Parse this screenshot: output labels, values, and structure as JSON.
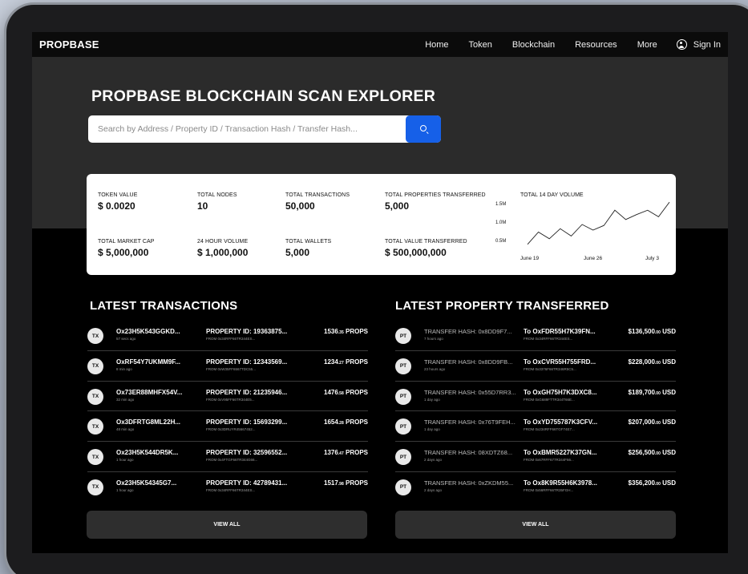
{
  "nav": {
    "logo": "PROPBASE",
    "links": [
      "Home",
      "Token",
      "Blockchain",
      "Resources",
      "More"
    ],
    "signin": "Sign In"
  },
  "hero": {
    "title": "PROPBASE BLOCKCHAIN SCAN EXPLORER",
    "search_placeholder": "Search by Address / Property ID / Transaction Hash / Transfer Hash..."
  },
  "stats": [
    {
      "label": "TOKEN VALUE",
      "value": "$ 0.0020"
    },
    {
      "label": "TOTAL NODES",
      "value": "10"
    },
    {
      "label": "TOTAL TRANSACTIONS",
      "value": "50,000"
    },
    {
      "label": "TOTAL PROPERTIES TRANSFERRED",
      "value": "5,000"
    },
    {
      "label": "TOTAL MARKET CAP",
      "value": "$ 5,000,000"
    },
    {
      "label": "24 HOUR VOLUME",
      "value": "$ 1,000,000"
    },
    {
      "label": "TOTAL WALLETS",
      "value": "5,000"
    },
    {
      "label": "TOTAL VALUE TRANSFERRED",
      "value": "$ 500,000,000"
    }
  ],
  "chart_data": {
    "type": "line",
    "title": "TOTAL 14 DAY VOLUME",
    "y_ticks": [
      "1.5M",
      "1.0M",
      "0.5M"
    ],
    "x_ticks": [
      "June 19",
      "June 26",
      "July 3"
    ],
    "values": [
      0.35,
      0.72,
      0.52,
      0.82,
      0.6,
      0.95,
      0.78,
      0.92,
      1.38,
      1.1,
      1.25,
      1.38,
      1.18,
      1.62
    ]
  },
  "transactions": {
    "title": "LATEST TRANSACTIONS",
    "badge": "TX",
    "unit": "PROPS",
    "rows": [
      {
        "hash": "Ox23H5K543GGKD...",
        "time": "57 secs ago",
        "property": "PROPERTY ID: 19363875...",
        "from": "FROM 0x34RFF66TR344ES...",
        "amount": "1536",
        "decimals": ".35"
      },
      {
        "hash": "OxRF54Y7UKMM9F...",
        "time": "8 min ago",
        "property": "PROPERTY ID: 12343569...",
        "from": "FROM 0xW35FF6567TDC55...",
        "amount": "1234",
        "decimals": ".27"
      },
      {
        "hash": "Ox73ER88MHFX54V...",
        "time": "32 min ago",
        "property": "PROPERTY ID: 21235946...",
        "from": "FROM 0xV95FF66TR344E5...",
        "amount": "1476",
        "decimals": ".58"
      },
      {
        "hash": "Ox3DFRTG8ML22H...",
        "time": "48 min ago",
        "property": "PROPERTY ID: 15693299...",
        "from": "FROM 0x3DRUYR45667452...",
        "amount": "1654",
        "decimals": ".28"
      },
      {
        "hash": "Ox23H5K544DR5K...",
        "time": "1 hour ago",
        "property": "PROPERTY ID: 32596552...",
        "from": "FROM 0x4FTGF66TR344G66...",
        "amount": "1376",
        "decimals": ".47"
      },
      {
        "hash": "Ox23H5K54345G7...",
        "time": "1 hour ago",
        "property": "PROPERTY ID: 42789431...",
        "from": "FROM 0x34RFF66TR344ES...",
        "amount": "1517",
        "decimals": ".98"
      }
    ],
    "view_all": "VIEW ALL"
  },
  "transfers": {
    "title": "LATEST PROPERTY TRANSFERRED",
    "badge": "PT",
    "currency": "USD",
    "rows": [
      {
        "hash": "TRANSFER HASH: 0x8DD9F7...",
        "time": "7 hours ago",
        "to": "To OxFDR55H7K39FN...",
        "from": "FROM 0x34RFF66TR344ES...",
        "amount": "$136,500",
        "decimals": ".00"
      },
      {
        "hash": "TRANSFER HASH: 0x8DD9FB...",
        "time": "23 hours ago",
        "to": "To OxCVR55H755FRD...",
        "from": "FROM 0x3376F66TR346R5C5...",
        "amount": "$228,000",
        "decimals": ".00"
      },
      {
        "hash": "TRANSFER HASH: 0x55D7RR3...",
        "time": "1 day ago",
        "to": "To OxGH75H7K3DXC8...",
        "from": "FROM 0xG689FTTR344T66E...",
        "amount": "$189,700",
        "decimals": ".00"
      },
      {
        "hash": "TRANSFER HASH: 0x76T9FEH...",
        "time": "1 day ago",
        "to": "To OxYD755787K3CFV...",
        "from": "FROM 0x234RFF66TGF74E7...",
        "amount": "$207,000",
        "decimals": ".00"
      },
      {
        "hash": "TRANSFER HASH: 08XDTZ68...",
        "time": "2 days ago",
        "to": "To OxBMR5227K37GN...",
        "from": "FROM 0x67RFF677R344F66...",
        "amount": "$256,500",
        "decimals": ".00"
      },
      {
        "hash": "TRANSFER HASH: 0xZKDM55...",
        "time": "2 days ago",
        "to": "To Ox8K9R55H6K3978...",
        "from": "FROM 0x56RFF66TR35FGH...",
        "amount": "$356,200",
        "decimals": ".00"
      }
    ],
    "view_all": "VIEW ALL"
  },
  "colors": {
    "accent": "#1660e8",
    "hero_bg": "#2b2b2b",
    "page_bg": "#000000",
    "card_bg": "#ffffff"
  }
}
